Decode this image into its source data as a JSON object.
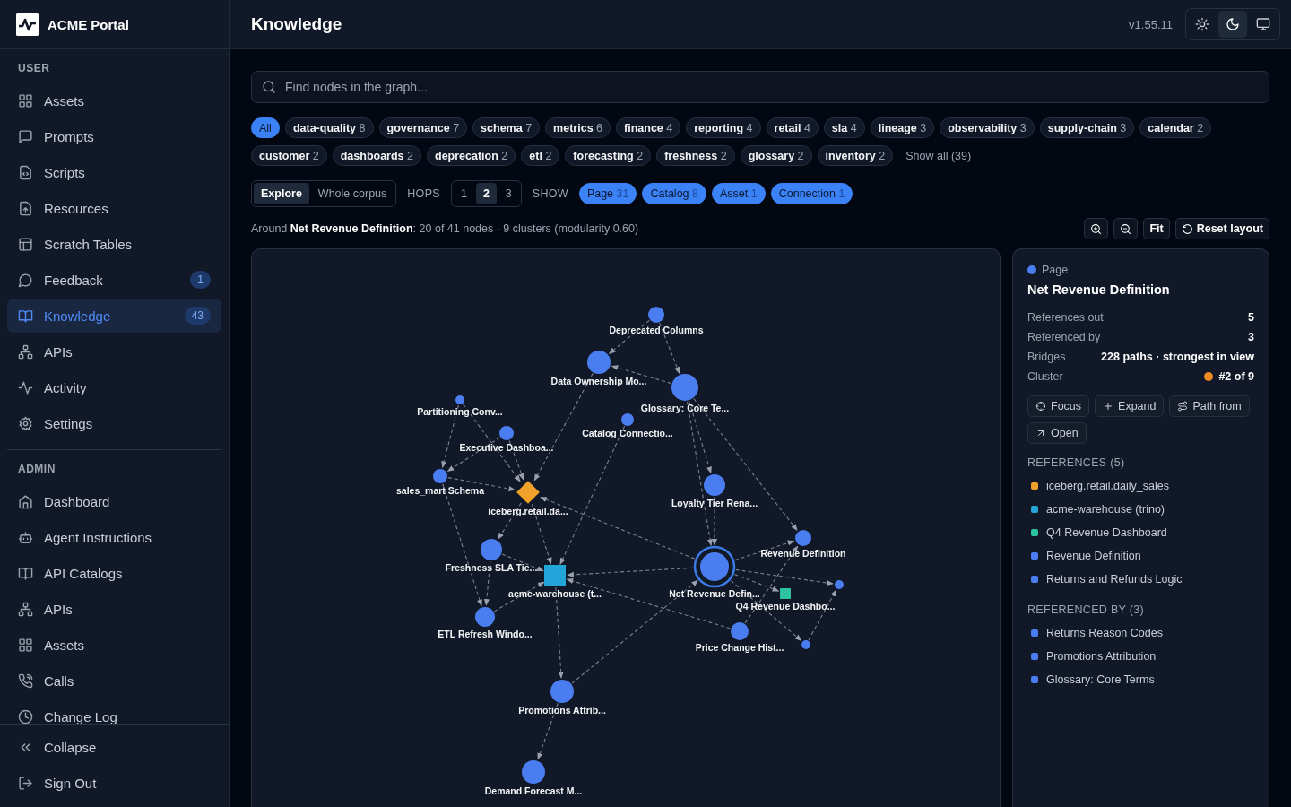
{
  "app": {
    "name": "ACME Portal"
  },
  "sidebar": {
    "sections": [
      {
        "title": "USER",
        "items": [
          {
            "label": "Assets",
            "selected": false
          },
          {
            "label": "Prompts",
            "selected": false
          },
          {
            "label": "Scripts",
            "selected": false
          },
          {
            "label": "Resources",
            "selected": false
          },
          {
            "label": "Scratch Tables",
            "selected": false
          },
          {
            "label": "Feedback",
            "badge": "1",
            "selected": false
          },
          {
            "label": "Knowledge",
            "badge": "43",
            "selected": true
          },
          {
            "label": "APIs",
            "selected": false
          },
          {
            "label": "Activity",
            "selected": false
          },
          {
            "label": "Settings",
            "selected": false
          }
        ]
      },
      {
        "title": "ADMIN",
        "items": [
          {
            "label": "Dashboard",
            "selected": false
          },
          {
            "label": "Agent Instructions",
            "selected": false
          },
          {
            "label": "API Catalogs",
            "selected": false
          },
          {
            "label": "APIs",
            "selected": false
          },
          {
            "label": "Assets",
            "selected": false
          },
          {
            "label": "Calls",
            "selected": false
          },
          {
            "label": "Change Log",
            "selected": false
          }
        ]
      }
    ],
    "footer": [
      {
        "label": "Collapse"
      },
      {
        "label": "Sign Out"
      }
    ]
  },
  "header": {
    "title": "Knowledge",
    "version": "v1.55.11",
    "theme_buttons": [
      {
        "kind": "light",
        "selected": false
      },
      {
        "kind": "dark",
        "selected": true
      },
      {
        "kind": "system",
        "selected": false
      }
    ]
  },
  "search": {
    "placeholder": "Find nodes in the graph..."
  },
  "tags": [
    {
      "label": "All",
      "selected": true
    },
    {
      "label": "data-quality",
      "count": "8",
      "selected": false
    },
    {
      "label": "governance",
      "count": "7",
      "selected": false
    },
    {
      "label": "schema",
      "count": "7",
      "selected": false
    },
    {
      "label": "metrics",
      "count": "6",
      "selected": false
    },
    {
      "label": "finance",
      "count": "4",
      "selected": false
    },
    {
      "label": "reporting",
      "count": "4",
      "selected": false
    },
    {
      "label": "retail",
      "count": "4",
      "selected": false
    },
    {
      "label": "sla",
      "count": "4",
      "selected": false
    },
    {
      "label": "lineage",
      "count": "3",
      "selected": false
    },
    {
      "label": "observability",
      "count": "3",
      "selected": false
    },
    {
      "label": "supply-chain",
      "count": "3",
      "selected": false
    },
    {
      "label": "calendar",
      "count": "2",
      "selected": false
    },
    {
      "label": "customer",
      "count": "2",
      "selected": false
    },
    {
      "label": "dashboards",
      "count": "2",
      "selected": false
    },
    {
      "label": "deprecation",
      "count": "2",
      "selected": false
    },
    {
      "label": "etl",
      "count": "2",
      "selected": false
    },
    {
      "label": "forecasting",
      "count": "2",
      "selected": false
    },
    {
      "label": "freshness",
      "count": "2",
      "selected": false
    },
    {
      "label": "glossary",
      "count": "2",
      "selected": false
    },
    {
      "label": "inventory",
      "count": "2",
      "selected": false
    }
  ],
  "show_all": "Show all (39)",
  "mode": [
    {
      "label": "Explore",
      "selected": true
    },
    {
      "label": "Whole corpus",
      "selected": false
    }
  ],
  "hops": {
    "label": "HOPS",
    "options": [
      {
        "label": "1",
        "selected": false
      },
      {
        "label": "2",
        "selected": true
      },
      {
        "label": "3",
        "selected": false
      }
    ]
  },
  "show": {
    "label": "SHOW",
    "filters": [
      {
        "label": "Page",
        "count": "31",
        "selected": true
      },
      {
        "label": "Catalog",
        "count": "8",
        "selected": true
      },
      {
        "label": "Asset",
        "count": "1",
        "selected": true
      },
      {
        "label": "Connection",
        "count": "1",
        "selected": true
      }
    ]
  },
  "caption": "Around **Net Revenue Definition**: 20 of 41 nodes · 9 clusters (modularity 0.60)",
  "graph_toolbar": [
    {
      "kind": "zoom-in"
    },
    {
      "kind": "zoom-out"
    },
    {
      "kind": "fit",
      "label": "Fit"
    },
    {
      "kind": "reset",
      "label": "Reset layout"
    }
  ],
  "graph": {
    "nodes": [
      {
        "label": "Deprecated Columns",
        "kind": "page",
        "color": "#4a7ef0",
        "selected": false
      },
      {
        "label": "Data Ownership Mo...",
        "kind": "page",
        "color": "#4a7ef0",
        "selected": false
      },
      {
        "label": "Glossary: Core Te...",
        "kind": "page",
        "color": "#4a7ef0",
        "selected": false
      },
      {
        "label": "Partitioning Conv...",
        "kind": "page",
        "color": "#4a7ef0",
        "selected": false
      },
      {
        "label": "Executive Dashboa...",
        "kind": "page",
        "color": "#4a7ef0",
        "selected": false
      },
      {
        "label": "Catalog Connectio...",
        "kind": "page",
        "color": "#4a7ef0",
        "selected": false
      },
      {
        "label": "sales_mart Schema",
        "kind": "page",
        "color": "#4a7ef0",
        "selected": false
      },
      {
        "label": "iceberg.retail.da...",
        "kind": "table",
        "color": "#f0a12a",
        "selected": false
      },
      {
        "label": "Loyalty Tier Rena...",
        "kind": "page",
        "color": "#4a7ef0",
        "selected": false
      },
      {
        "label": "Freshness SLA Tie...",
        "kind": "page",
        "color": "#4a7ef0",
        "selected": false
      },
      {
        "label": "acme-warehouse (t...",
        "kind": "connection",
        "color": "#22a5d8",
        "selected": false
      },
      {
        "label": "Net Revenue Defin...",
        "kind": "page",
        "color": "#4a7ef0",
        "selected": true
      },
      {
        "label": "Revenue Definition",
        "kind": "page",
        "color": "#4a7ef0",
        "selected": false
      },
      {
        "label": "Q4 Revenue Dashbo...",
        "kind": "asset",
        "color": "#2cc4a0",
        "selected": false
      },
      {
        "kind": "page",
        "color": "#4a7ef0",
        "selected": false
      },
      {
        "label": "ETL Refresh Windo...",
        "kind": "page",
        "color": "#4a7ef0",
        "selected": false
      },
      {
        "label": "Price Change Hist...",
        "kind": "page",
        "color": "#4a7ef0",
        "selected": false
      },
      {
        "kind": "page",
        "color": "#4a7ef0",
        "selected": false
      },
      {
        "label": "Promotions Attrib...",
        "kind": "page",
        "color": "#4a7ef0",
        "selected": false
      },
      {
        "label": "Demand Forecast M...",
        "kind": "page",
        "color": "#4a7ef0",
        "selected": false
      }
    ]
  },
  "details": {
    "kind": "Page",
    "color": "#4a7ef0",
    "title": "Net Revenue Definition",
    "stats": [
      {
        "label": "References out",
        "value": "5"
      },
      {
        "label": "Referenced by",
        "value": "3"
      },
      {
        "label": "Bridges",
        "value": "228 paths · strongest in view"
      },
      {
        "label": "Cluster",
        "value": "#2 of 9",
        "color": "#f08a24"
      }
    ],
    "actions": [
      {
        "kind": "focus",
        "label": "Focus"
      },
      {
        "kind": "expand",
        "label": "Expand"
      },
      {
        "kind": "path",
        "label": "Path from"
      },
      {
        "kind": "open",
        "label": "Open"
      }
    ],
    "lists": [
      {
        "title": "REFERENCES (5)",
        "items": [
          {
            "label": "iceberg.retail.daily_sales",
            "color": "#f0a12a"
          },
          {
            "label": "acme-warehouse (trino)",
            "color": "#22a5d8"
          },
          {
            "label": "Q4 Revenue Dashboard",
            "color": "#2cc4a0"
          },
          {
            "label": "Revenue Definition",
            "color": "#4a7ef0"
          },
          {
            "label": "Returns and Refunds Logic",
            "color": "#4a7ef0"
          }
        ]
      },
      {
        "title": "REFERENCED BY (3)",
        "items": [
          {
            "label": "Returns Reason Codes",
            "color": "#4a7ef0"
          },
          {
            "label": "Promotions Attribution",
            "color": "#4a7ef0"
          },
          {
            "label": "Glossary: Core Terms",
            "color": "#4a7ef0"
          }
        ]
      }
    ]
  }
}
